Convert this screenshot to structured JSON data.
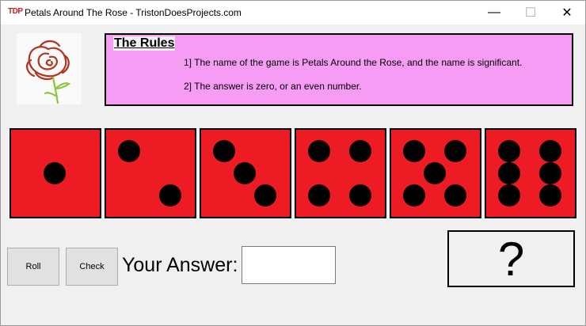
{
  "window": {
    "title": "Petals Around The Rose - TristonDoesProjects.com",
    "icon_text": "TDP",
    "controls": {
      "minimize": "—",
      "maximize": "☐",
      "close": "✕"
    }
  },
  "rules": {
    "heading": "The Rules",
    "items": [
      "1] The name of the game is Petals Around the Rose, and the name is significant.",
      "2] The answer is zero, or an even number."
    ]
  },
  "dice": [
    {
      "value": 1
    },
    {
      "value": 2
    },
    {
      "value": 3
    },
    {
      "value": 4
    },
    {
      "value": 5
    },
    {
      "value": 6
    }
  ],
  "controls": {
    "roll_label": "Roll",
    "check_label": "Check",
    "answer_label": "Your Answer:",
    "answer_value": ""
  },
  "result": {
    "text": "?"
  },
  "colors": {
    "die_face": "#ed1c24",
    "rules_background": "#f69cf4",
    "rose_red": "#b2331e",
    "rose_stem": "#8cc63f"
  },
  "icons": {
    "logo": "rose-icon"
  }
}
